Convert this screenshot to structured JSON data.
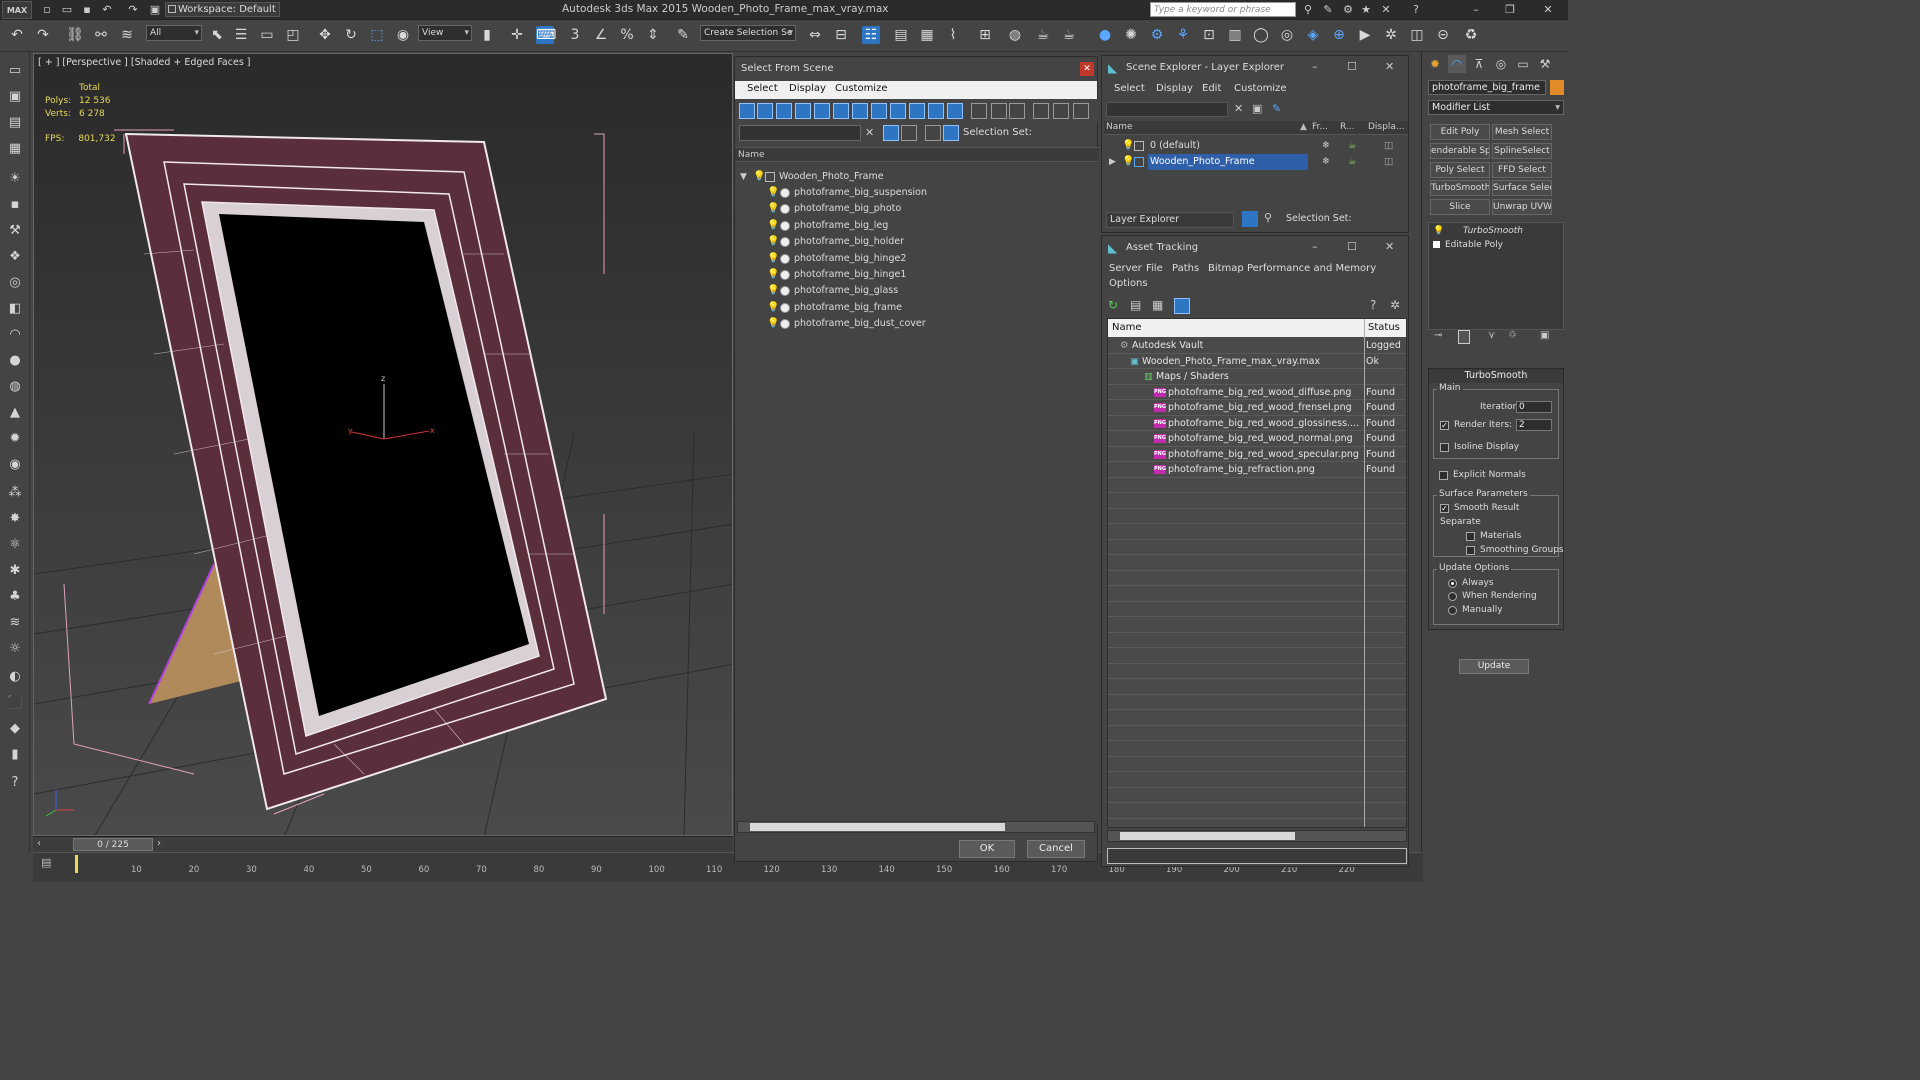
{
  "titlebar": {
    "app_logo": "MAX",
    "workspace": "Workspace: Default",
    "app_title": "Autodesk 3ds Max  2015       Wooden_Photo_Frame_max_vray.max",
    "search_placeholder": "Type a keyword or phrase"
  },
  "toolbar": {
    "selection_filter": "All",
    "ref_coord": "View",
    "named_selection": "Create Selection Se",
    "snaps": "3"
  },
  "viewport": {
    "label": "[ + ] [Perspective ] [Shaded + Edged Faces ]",
    "stats_header": "Total",
    "polys_label": "Polys:",
    "polys_value": "12 536",
    "verts_label": "Verts:",
    "verts_value": "6 278",
    "fps_label": "FPS:",
    "fps_value": "801,732",
    "axis_x": "x",
    "axis_y": "y",
    "axis_z": "z"
  },
  "timeline": {
    "slider": "0 / 225",
    "ticks": [
      "10",
      "20",
      "30",
      "40",
      "50",
      "60",
      "70",
      "80",
      "90",
      "100",
      "110",
      "120",
      "130",
      "140",
      "150",
      "160",
      "170",
      "180",
      "190",
      "200",
      "210",
      "220"
    ]
  },
  "select_from_scene": {
    "title": "Select From Scene",
    "menus": [
      "Select",
      "Display",
      "Customize"
    ],
    "selection_set_label": "Selection Set:",
    "column_name": "Name",
    "root": "Wooden_Photo_Frame",
    "children": [
      "photoframe_big_suspension",
      "photoframe_big_photo",
      "photoframe_big_leg",
      "photoframe_big_holder",
      "photoframe_big_hinge2",
      "photoframe_big_hinge1",
      "photoframe_big_glass",
      "photoframe_big_frame",
      "photoframe_big_dust_cover"
    ],
    "ok": "OK",
    "cancel": "Cancel"
  },
  "scene_explorer": {
    "title": "Scene Explorer - Layer Explorer",
    "menus": [
      "Select",
      "Display",
      "Edit",
      "Customize"
    ],
    "col_name": "Name",
    "col_fr": "Fr...",
    "col_r": "R...",
    "col_display": "Displa...",
    "layers": [
      "0 (default)",
      "Wooden_Photo_Frame"
    ],
    "footer_drop": "Layer Explorer",
    "selection_set_label": "Selection Set:"
  },
  "asset_tracking": {
    "title": "Asset Tracking",
    "menus": [
      "Server",
      "File",
      "Paths",
      "Bitmap Performance and Memory"
    ],
    "menu_options": "Options",
    "col_name": "Name",
    "col_status": "Status",
    "rows": [
      {
        "name": "Autodesk Vault",
        "status": "Logged"
      },
      {
        "name": "Wooden_Photo_Frame_max_vray.max",
        "status": "Ok"
      },
      {
        "name": "Maps / Shaders",
        "status": ""
      },
      {
        "name": "photoframe_big_red_wood_diffuse.png",
        "status": "Found"
      },
      {
        "name": "photoframe_big_red_wood_frensel.png",
        "status": "Found"
      },
      {
        "name": "photoframe_big_red_wood_glossiness....",
        "status": "Found"
      },
      {
        "name": "photoframe_big_red_wood_normal.png",
        "status": "Found"
      },
      {
        "name": "photoframe_big_red_wood_specular.png",
        "status": "Found"
      },
      {
        "name": "photoframe_big_refraction.png",
        "status": "Found"
      }
    ],
    "png_tag": "PNG"
  },
  "command_panel": {
    "object_name": "photoframe_big_frame",
    "modifier_list": "Modifier List",
    "buttons": [
      [
        "Edit Poly",
        "Mesh Select"
      ],
      [
        "enderable Splin",
        "SplineSelect"
      ],
      [
        "Poly Select",
        "FFD Select"
      ],
      [
        "TurboSmooth",
        "Surface Select"
      ],
      [
        "Slice",
        "Unwrap UVW"
      ]
    ],
    "stack": [
      "TurboSmooth",
      "Editable Poly"
    ],
    "rollout_title": "TurboSmooth",
    "main_group": "Main",
    "iterations_label": "Iterations:",
    "iterations_value": "0",
    "render_iters_label": "Render Iters:",
    "render_iters_value": "2",
    "isoline": "Isoline Display",
    "explicit_normals": "Explicit Normals",
    "surface_group": "Surface Parameters",
    "smooth_result": "Smooth Result",
    "separate_label": "Separate",
    "materials": "Materials",
    "smoothing_groups": "Smoothing Groups",
    "update_group": "Update Options",
    "always": "Always",
    "when_rendering": "When Rendering",
    "manually": "Manually",
    "update_btn": "Update"
  }
}
